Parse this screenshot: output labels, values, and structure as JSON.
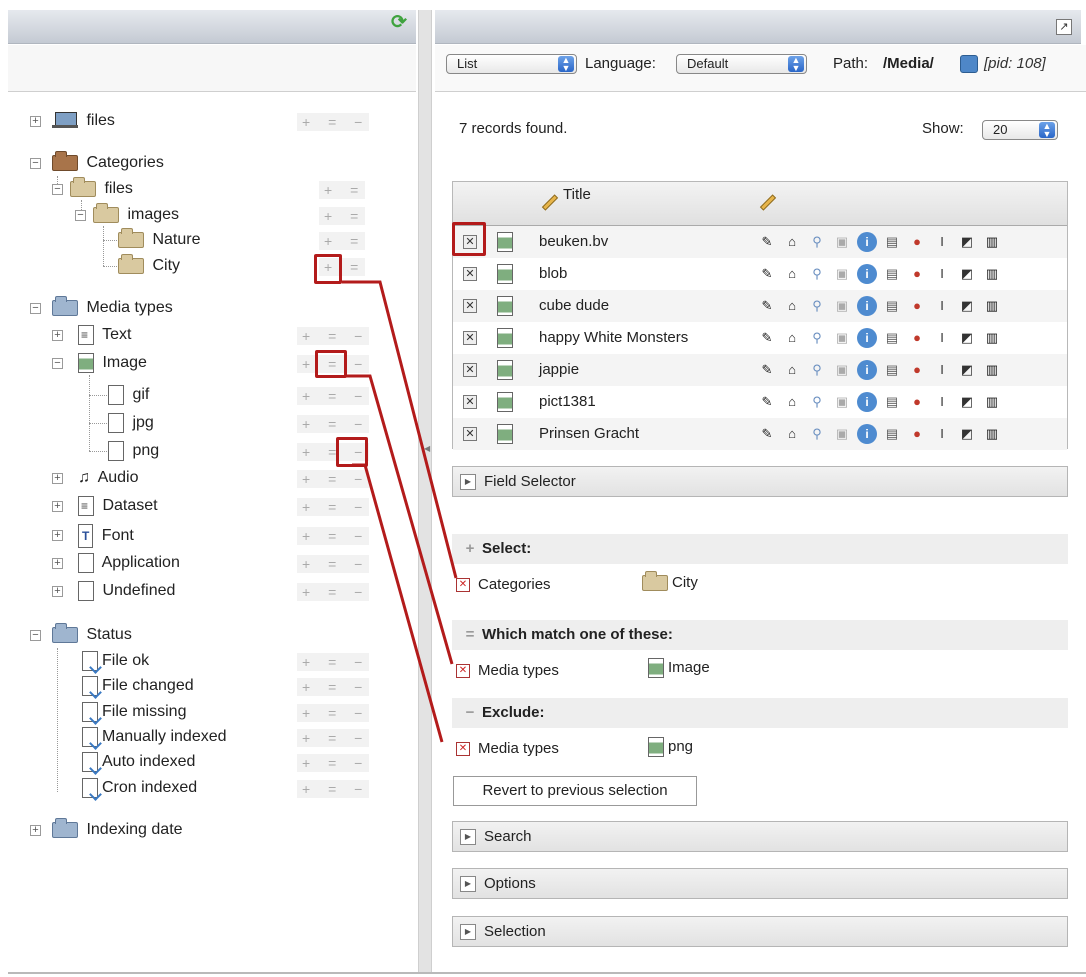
{
  "left": {
    "tree": {
      "files": {
        "label": "files"
      },
      "categories": {
        "label": "Categories",
        "children": [
          {
            "label": "files"
          },
          {
            "label": "images"
          },
          {
            "label": "Nature"
          },
          {
            "label": "City"
          }
        ]
      },
      "media_types": {
        "label": "Media types",
        "children": [
          {
            "label": "Text"
          },
          {
            "label": "Image"
          },
          {
            "label": "gif"
          },
          {
            "label": "jpg"
          },
          {
            "label": "png"
          },
          {
            "label": "Audio"
          },
          {
            "label": "Dataset"
          },
          {
            "label": "Font"
          },
          {
            "label": "Application"
          },
          {
            "label": "Undefined"
          }
        ]
      },
      "status": {
        "label": "Status",
        "children": [
          {
            "label": "File ok"
          },
          {
            "label": "File changed"
          },
          {
            "label": "File missing"
          },
          {
            "label": "Manually indexed"
          },
          {
            "label": "Auto indexed"
          },
          {
            "label": "Cron indexed"
          }
        ]
      },
      "indexing_date": {
        "label": "Indexing date"
      }
    },
    "plus_minus_equal": "+ = −",
    "plus_equal": "+ ="
  },
  "toolbar": {
    "view_select": "List",
    "language_label": "Language:",
    "language_select": "Default",
    "path_label": "Path:",
    "path_value": "/Media/",
    "pid": "[pid: 108]"
  },
  "list": {
    "records_found": "7 records found.",
    "show_label": "Show:",
    "show_value": "20",
    "column_title": "Title",
    "records": [
      {
        "title": "beuken.bv"
      },
      {
        "title": "blob"
      },
      {
        "title": "cube dude"
      },
      {
        "title": "happy White Monsters"
      },
      {
        "title": "jappie"
      },
      {
        "title": "pict1381"
      },
      {
        "title": "Prinsen Gracht"
      }
    ]
  },
  "sections": {
    "field_selector": "Field Selector",
    "search": "Search",
    "options": "Options",
    "selection": "Selection"
  },
  "selection": {
    "select_label": "Select:",
    "match_label": "Which match one of these:",
    "exclude_label": "Exclude:",
    "criteria": [
      {
        "field": "Categories",
        "value": "City"
      },
      {
        "field": "Media types",
        "value": "Image"
      },
      {
        "field": "Media types",
        "value": "png"
      }
    ],
    "revert_button": "Revert to previous selection"
  },
  "colors": {
    "annotation_red": "#b31b1b",
    "header_bar": "#c4cad3",
    "accent_blue": "#2a66c8"
  }
}
